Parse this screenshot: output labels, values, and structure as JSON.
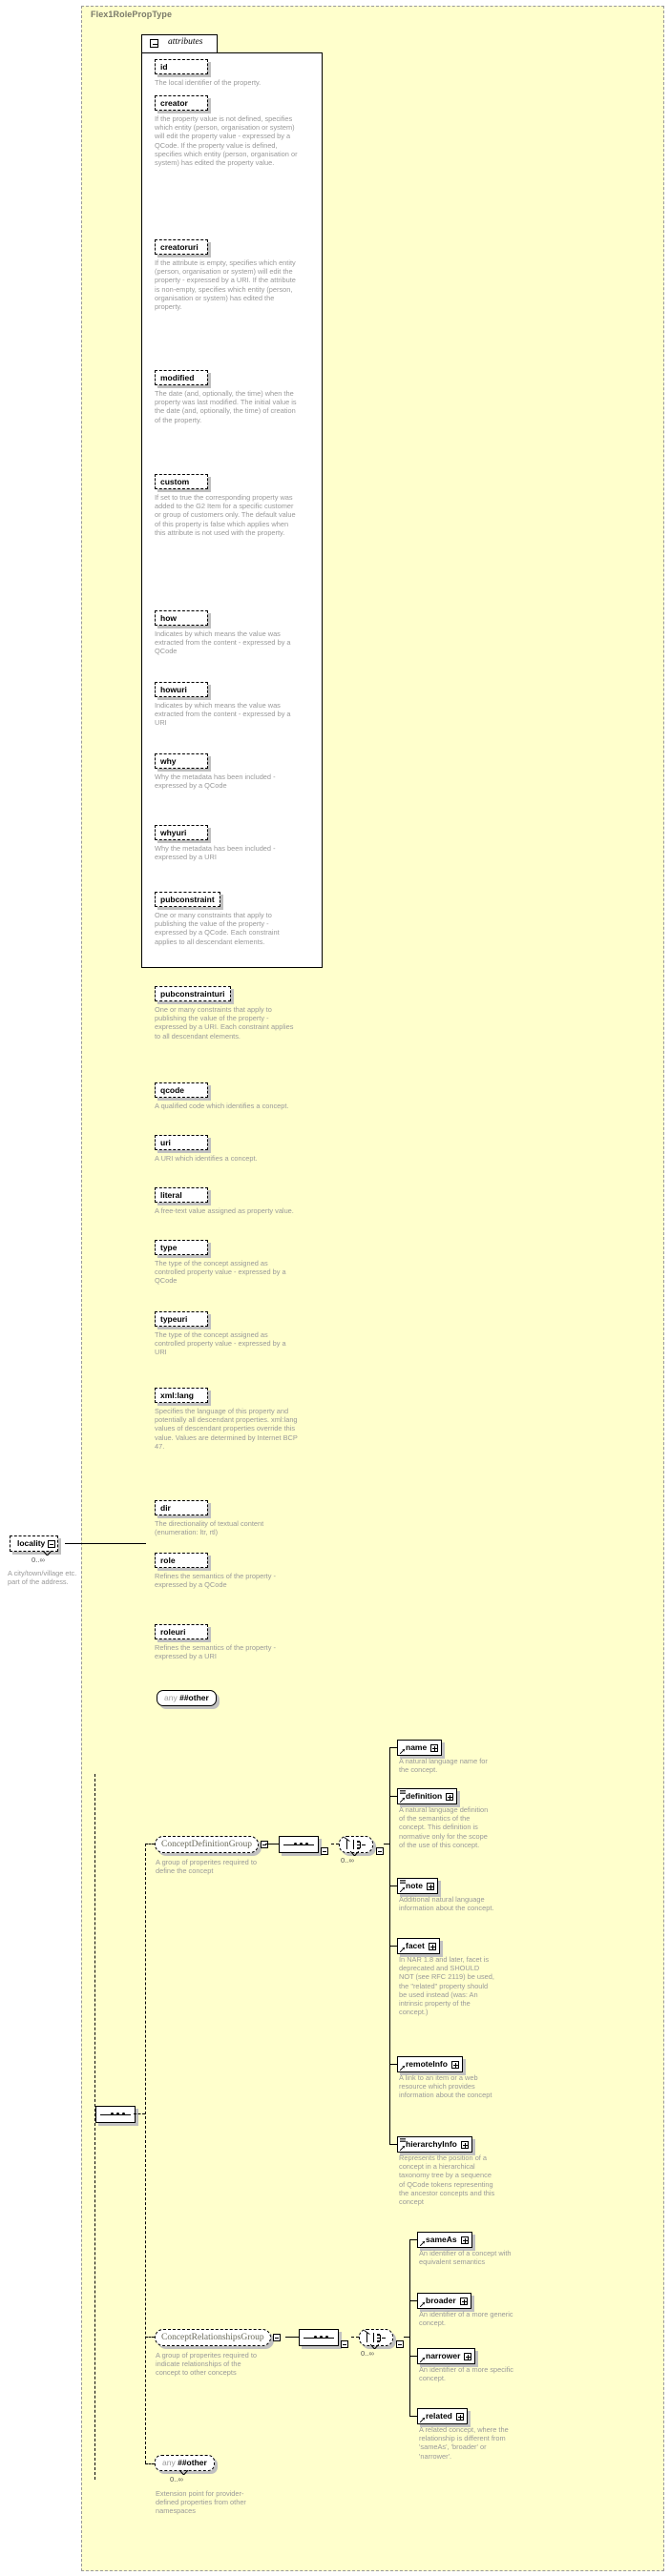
{
  "diagram": {
    "type_name": "Flex1RolePropType",
    "attributes_section_label": "attributes",
    "colors": {
      "background": "#ffffcc",
      "border": "#999999",
      "text": "#9a9a9a",
      "box": "#ffffff"
    }
  },
  "attributes": [
    {
      "name": "id",
      "desc": "The local identifier of the property."
    },
    {
      "name": "creator",
      "desc": "If the property value is not defined, specifies which entity (person, organisation or system) will edit the property value - expressed by a QCode. If the property value is defined, specifies which entity (person, organisation or system) has edited the property value."
    },
    {
      "name": "creatoruri",
      "desc": "If the attribute is empty, specifies which entity (person, organisation or system) will edit the property - expressed by a URI. If the attribute is non-empty, specifies which entity (person, organisation or system) has edited the property."
    },
    {
      "name": "modified",
      "desc": "The date (and, optionally, the time) when the property was last modified. The initial value is the date (and, optionally, the time) of creation of the property."
    },
    {
      "name": "custom",
      "desc": "If set to true the corresponding property was added to the G2 Item for a specific customer or group of customers only. The default value of this property is false which applies when this attribute is not used with the property."
    },
    {
      "name": "how",
      "desc": "Indicates by which means the value was extracted from the content - expressed by a QCode"
    },
    {
      "name": "howuri",
      "desc": "Indicates by which means the value was extracted from the content - expressed by a URI"
    },
    {
      "name": "why",
      "desc": "Why the metadata has been included - expressed by a QCode"
    },
    {
      "name": "whyuri",
      "desc": "Why the metadata has been included - expressed by a URI"
    },
    {
      "name": "pubconstraint",
      "desc": "One or many constraints that apply to publishing the value of the property - expressed by a QCode. Each constraint applies to all descendant elements."
    },
    {
      "name": "pubconstrainturi",
      "desc": "One or many constraints that apply to publishing the value of the property - expressed by a URI. Each constraint applies to all descendant elements."
    },
    {
      "name": "qcode",
      "desc": "A qualified code which identifies a concept."
    },
    {
      "name": "uri",
      "desc": "A URI which identifies a concept."
    },
    {
      "name": "literal",
      "desc": "A free-text value assigned as property value."
    },
    {
      "name": "type",
      "desc": "The type of the concept assigned as controlled property value - expressed by a QCode"
    },
    {
      "name": "typeuri",
      "desc": "The type of the concept assigned as controlled property value - expressed by a URI"
    },
    {
      "name": "xml:lang",
      "desc": "Specifies the language of this property and potentially all descendant properties. xml:lang values of descendant properties override this value. Values are determined by Internet BCP 47."
    },
    {
      "name": "dir",
      "desc": "The directionality of textual content (enumeration: ltr, rtl)"
    },
    {
      "name": "role",
      "desc": "Refines the semantics of the property - expressed by a QCode"
    },
    {
      "name": "roleuri",
      "desc": "Refines the semantics of the property - expressed by a URI"
    }
  ],
  "attributes_any": {
    "key": "any",
    "value": "##other"
  },
  "root_element": {
    "name": "locality",
    "cardinality": "0..∞",
    "desc": "A city/town/village etc. part of the address."
  },
  "groups": [
    {
      "name": "ConceptDefinitionGroup",
      "desc": "A group of properites required to define the concept",
      "cardinality": "0..∞",
      "children": [
        {
          "name": "name",
          "desc": "A natural language name for the concept."
        },
        {
          "name": "definition",
          "desc": "A natural language definition of the semantics of the concept. This definition is normative only for the scope of the use of this concept."
        },
        {
          "name": "note",
          "desc": "Additional natural language information about the concept."
        },
        {
          "name": "facet",
          "desc": "In NAR 1.8 and later, facet is deprecated and SHOULD NOT (see RFC 2119) be used, the \"related\" property should be used instead (was: An intrinsic property of the concept.)"
        },
        {
          "name": "remoteInfo",
          "desc": "A link to an item or a web resource which provides information about the concept"
        },
        {
          "name": "hierarchyInfo",
          "desc": "Represents the position of a concept in a hierarchical taxonomy tree by a sequence of QCode tokens representing the ancestor concepts and this concept"
        }
      ]
    },
    {
      "name": "ConceptRelationshipsGroup",
      "desc": "A group of properites required to indicate relationships of the concept to other concepts",
      "cardinality": "0..∞",
      "children": [
        {
          "name": "sameAs",
          "desc": "An identifier of a concept with equivalent semantics"
        },
        {
          "name": "broader",
          "desc": "An identifier of a more generic concept."
        },
        {
          "name": "narrower",
          "desc": "An identifier of a more specific concept."
        },
        {
          "name": "related",
          "desc": "A related concept, where the relationship is different from 'sameAs', 'broader' or 'narrower'."
        }
      ]
    }
  ],
  "extension_point": {
    "key": "any",
    "value": "##other",
    "cardinality": "0..∞",
    "desc": "Extension point for provider-defined properties from other namespaces"
  }
}
